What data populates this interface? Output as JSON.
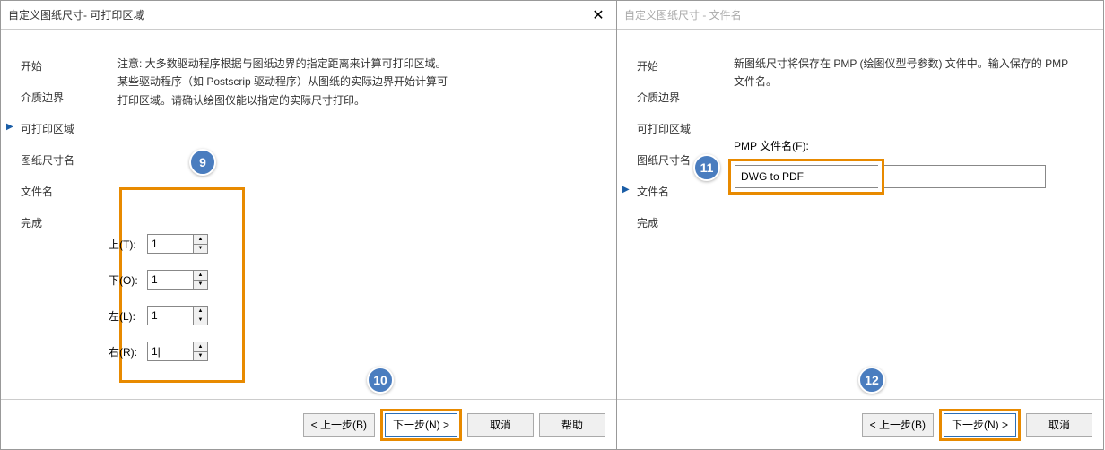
{
  "left": {
    "title": "自定义图纸尺寸- 可打印区域",
    "sidebar": [
      "开始",
      "介质边界",
      "可打印区域",
      "图纸尺寸名",
      "文件名",
      "完成"
    ],
    "activeIndex": 2,
    "desc": "注意: 大多数驱动程序根据与图纸边界的指定距离来计算可打印区域。某些驱动程序（如 Postscrip 驱动程序）从图纸的实际边界开始计算可打印区域。请确认绘图仪能以指定的实际尺寸打印。",
    "margins": {
      "top": {
        "label": "上(T):",
        "value": "1"
      },
      "bottom": {
        "label": "下(O):",
        "value": "1"
      },
      "left": {
        "label": "左(L):",
        "value": "1"
      },
      "right": {
        "label": "右(R):",
        "value": "1|"
      }
    },
    "buttons": {
      "back": "< 上一步(B)",
      "next": "下一步(N) >",
      "cancel": "取消",
      "help": "帮助"
    },
    "badges": {
      "b9": "9",
      "b10": "10"
    }
  },
  "right": {
    "title": "自定义图纸尺寸 - 文件名",
    "sidebar": [
      "开始",
      "介质边界",
      "可打印区域",
      "图纸尺寸名",
      "文件名",
      "完成"
    ],
    "activeIndex": 4,
    "desc": "新图纸尺寸将保存在 PMP (绘图仪型号参数) 文件中。输入保存的 PMP 文件名。",
    "pmpLabel": "PMP 文件名(F):",
    "pmpValue": "DWG to PDF",
    "buttons": {
      "back": "< 上一步(B)",
      "next": "下一步(N) >",
      "cancel": "取消"
    },
    "badges": {
      "b11": "11",
      "b12": "12"
    }
  }
}
